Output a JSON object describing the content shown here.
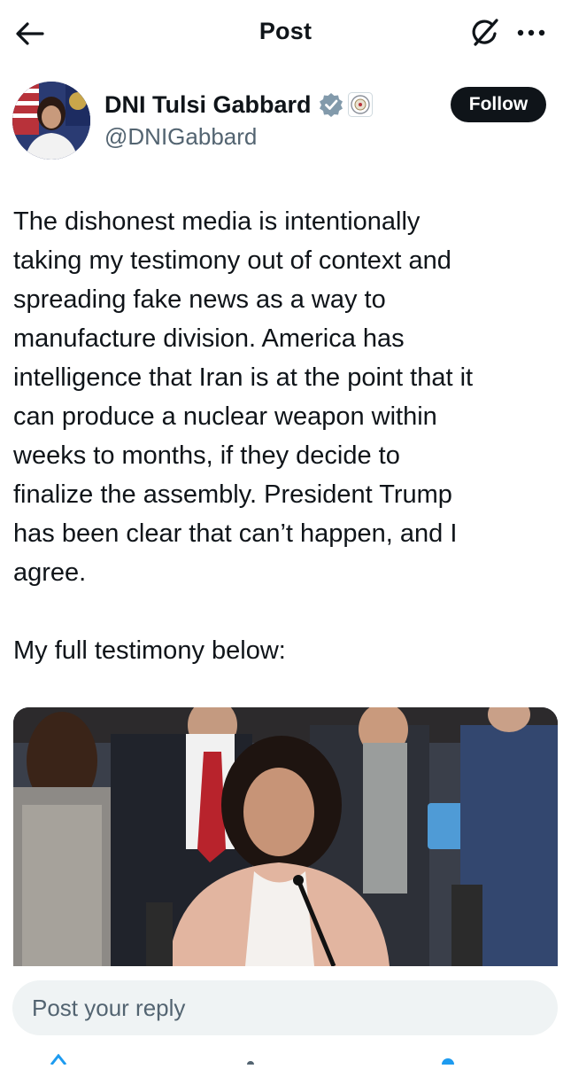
{
  "header": {
    "title": "Post",
    "back_icon": "arrow-left-icon",
    "grok_icon": "grok-icon",
    "more_icon": "more-horizontal-icon"
  },
  "author": {
    "display_name": "DNI Tulsi Gabbard",
    "handle": "@DNIGabbard",
    "verified_badge": "verified-gray-badge-icon",
    "affiliation_badge": "dni-seal-icon",
    "follow_label": "Follow"
  },
  "post": {
    "text": "The dishonest media is intentionally\ntaking my testimony out of context and\nspreading fake news as a way to\nmanufacture division. America has\nintelligence that Iran is at the point that it\ncan produce a nuclear weapon within\nweeks to months, if they decide to\nfinalize the assembly. President Trump\nhas been clear that can’t happen, and I\nagree.\n\nMy full testimony below:"
  },
  "media": {
    "kind": "video-thumbnail"
  },
  "reply": {
    "placeholder": "Post your reply"
  },
  "colors": {
    "text": "#0f1419",
    "secondary": "#536471",
    "follow_bg": "#0f1419",
    "reply_bg": "#eff3f4",
    "verified_gray": "#829aab"
  }
}
